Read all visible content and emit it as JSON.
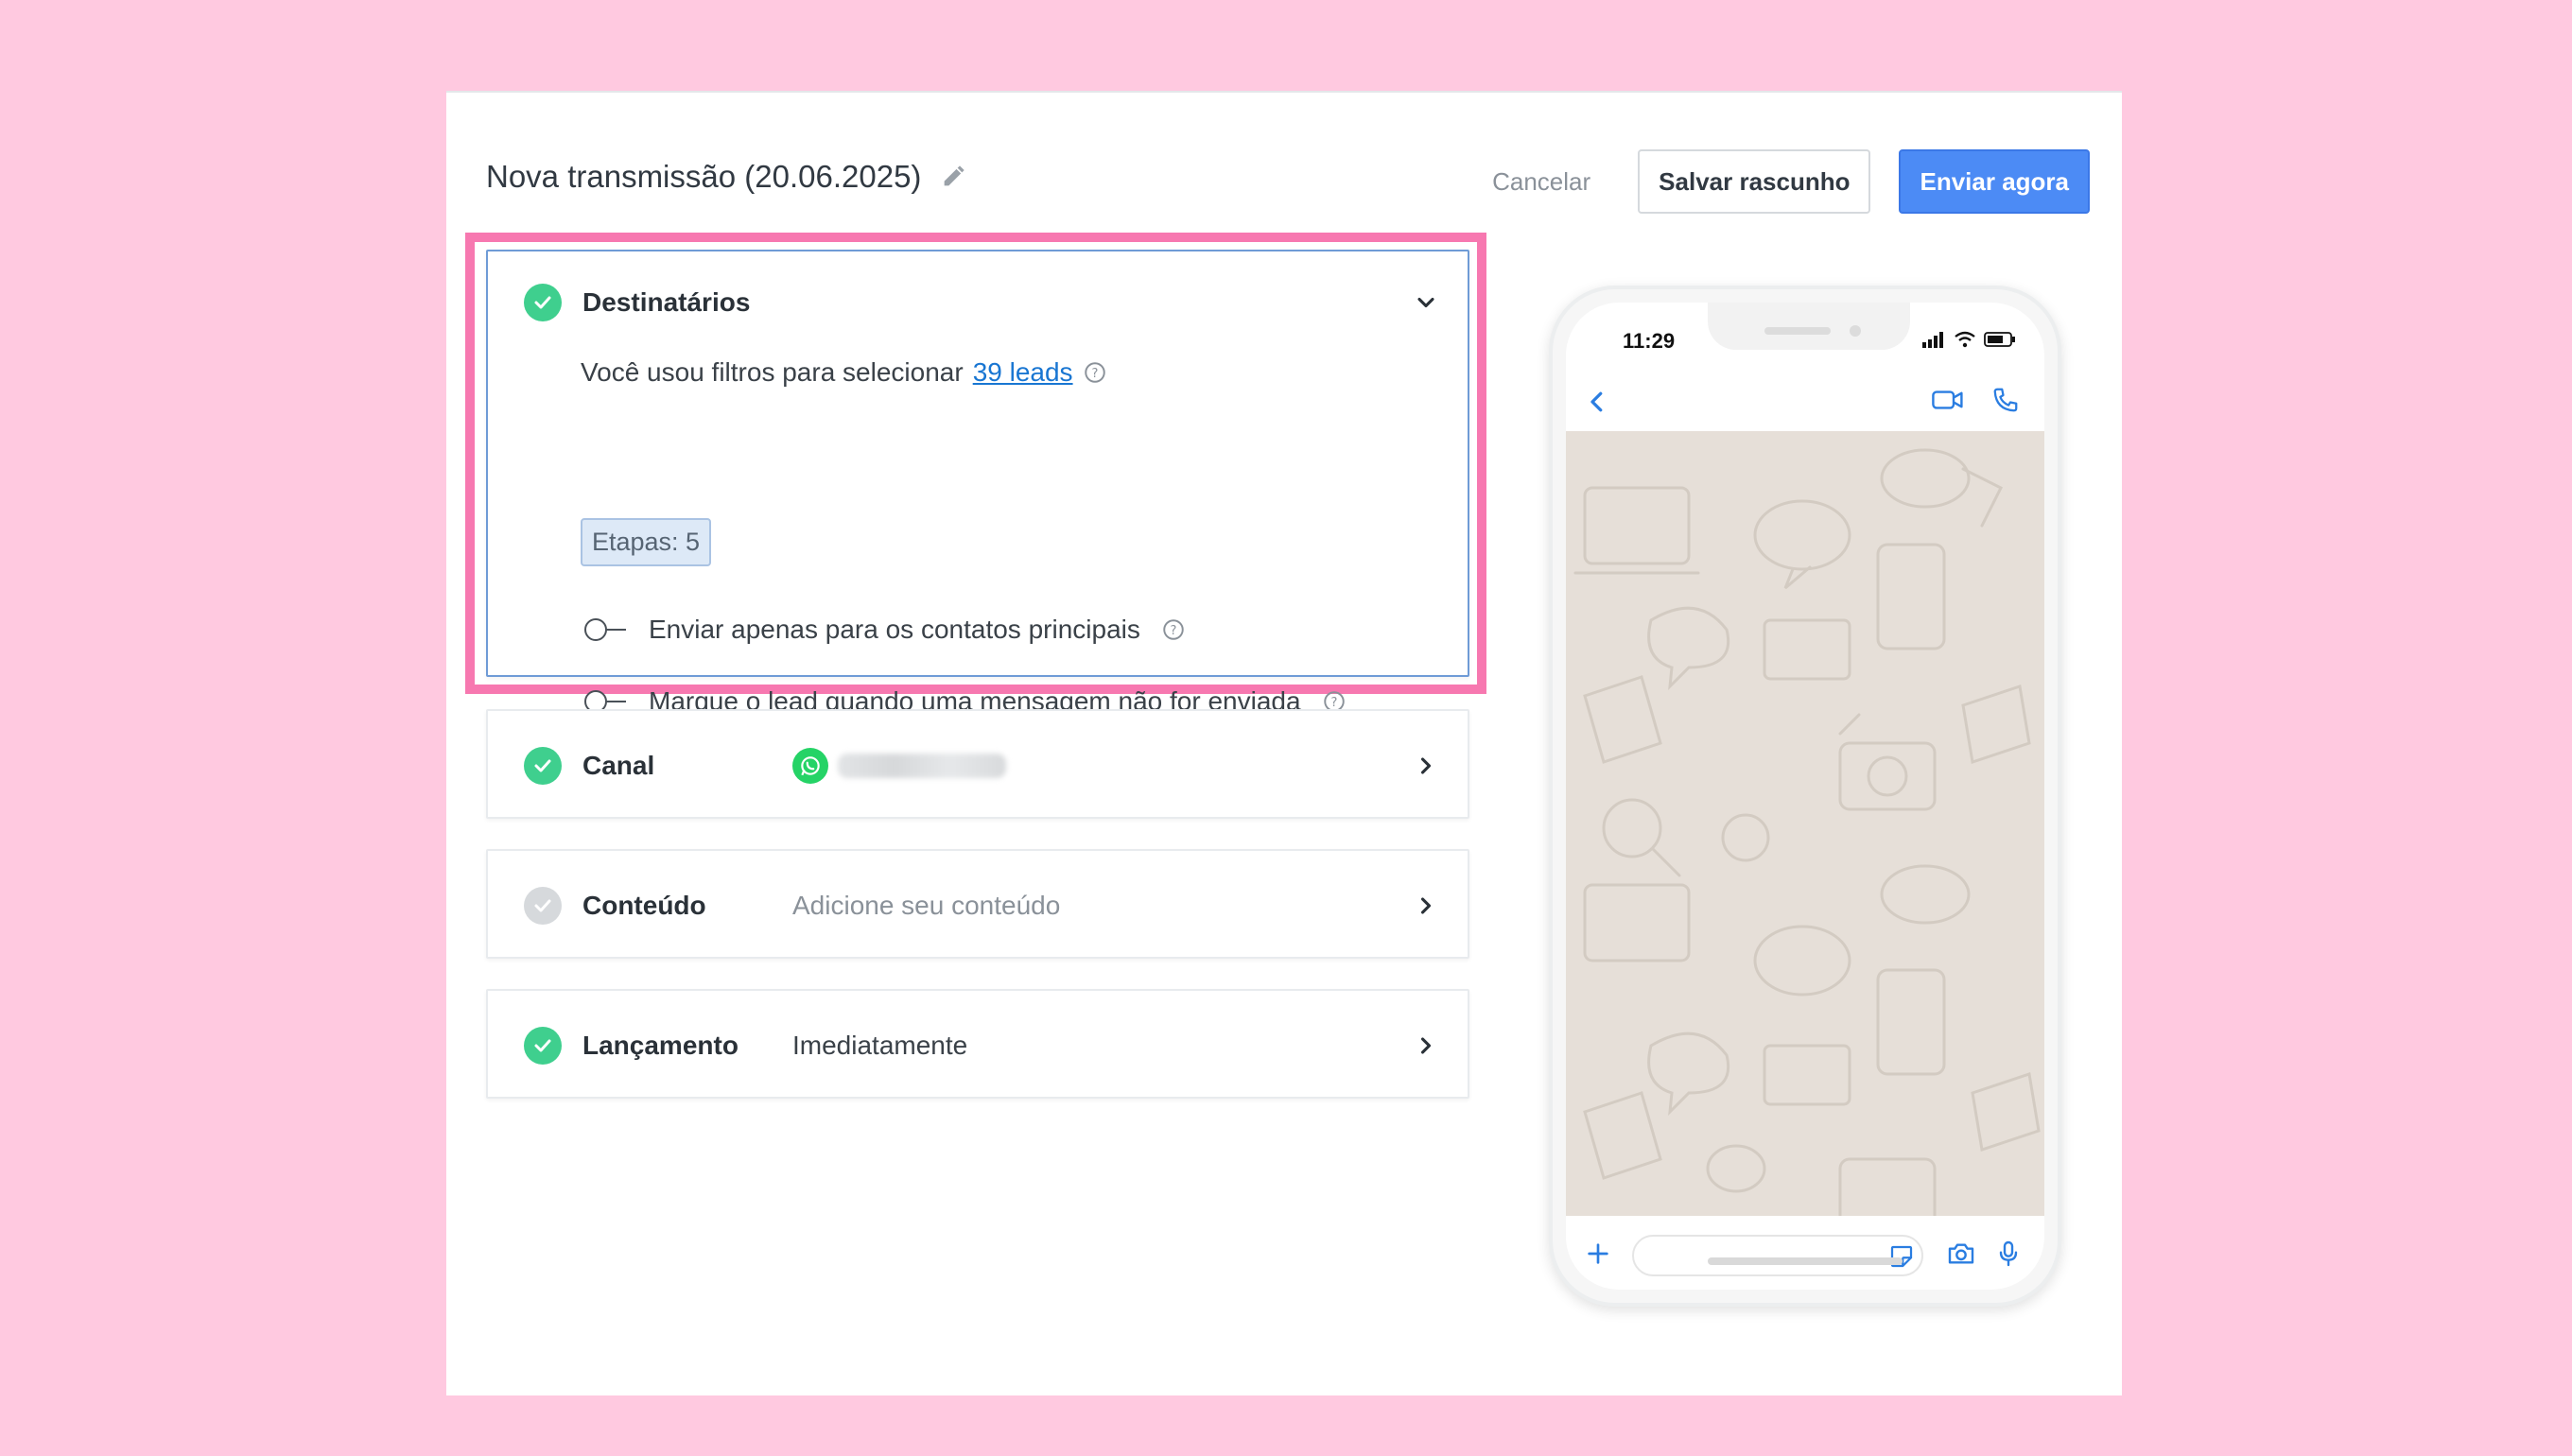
{
  "header": {
    "title": "Nova transmissão (20.06.2025)",
    "cancel_label": "Cancelar",
    "draft_label": "Salvar rascunho",
    "send_label": "Enviar agora"
  },
  "recipients": {
    "title": "Destinatários",
    "filter_text": "Você usou filtros para selecionar",
    "leads_link": "39 leads",
    "tag": "Etapas: 5",
    "toggle_main_contacts": "Enviar apenas para os contatos principais",
    "toggle_mark_lead": "Marque o lead quando uma mensagem não for enviada"
  },
  "channel": {
    "title": "Canal",
    "icon": "whatsapp-icon"
  },
  "content": {
    "title": "Conteúdo",
    "value": "Adicione seu conteúdo"
  },
  "launch": {
    "title": "Lançamento",
    "value": "Imediatamente"
  },
  "phone": {
    "time": "11:29"
  },
  "colors": {
    "accent": "#4c8bf5",
    "success": "#3fcf8e",
    "highlight": "#f778b0",
    "background": "#ffc9e0",
    "link": "#1976d2"
  }
}
